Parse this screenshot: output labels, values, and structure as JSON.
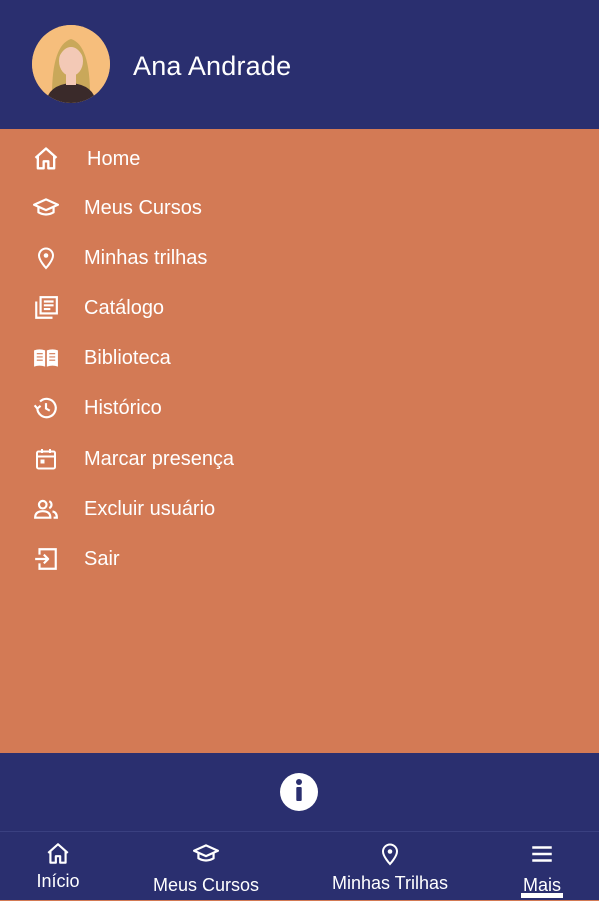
{
  "header": {
    "user_name": "Ana Andrade",
    "avatar_icon": "user-avatar"
  },
  "menu": {
    "items": [
      {
        "label": "Home",
        "icon": "home-icon"
      },
      {
        "label": "Meus Cursos",
        "icon": "graduation-cap-icon"
      },
      {
        "label": "Minhas trilhas",
        "icon": "location-pin-icon"
      },
      {
        "label": "Catálogo",
        "icon": "catalog-icon"
      },
      {
        "label": "Biblioteca",
        "icon": "book-open-icon"
      },
      {
        "label": "Histórico",
        "icon": "history-icon"
      },
      {
        "label": "Marcar presença",
        "icon": "calendar-icon"
      },
      {
        "label": "Excluir usuário",
        "icon": "users-icon"
      },
      {
        "label": "Sair",
        "icon": "logout-icon"
      }
    ]
  },
  "info": {
    "icon": "info-icon"
  },
  "bottom_nav": {
    "items": [
      {
        "label": "Início",
        "icon": "home-icon"
      },
      {
        "label": "Meus Cursos",
        "icon": "graduation-cap-icon"
      },
      {
        "label": "Minhas Trilhas",
        "icon": "location-pin-icon"
      },
      {
        "label": "Mais",
        "icon": "menu-icon",
        "active": true
      }
    ]
  },
  "colors": {
    "header_bg": "#2a2f6f",
    "menu_bg": "#d37a55",
    "text": "#ffffff"
  }
}
